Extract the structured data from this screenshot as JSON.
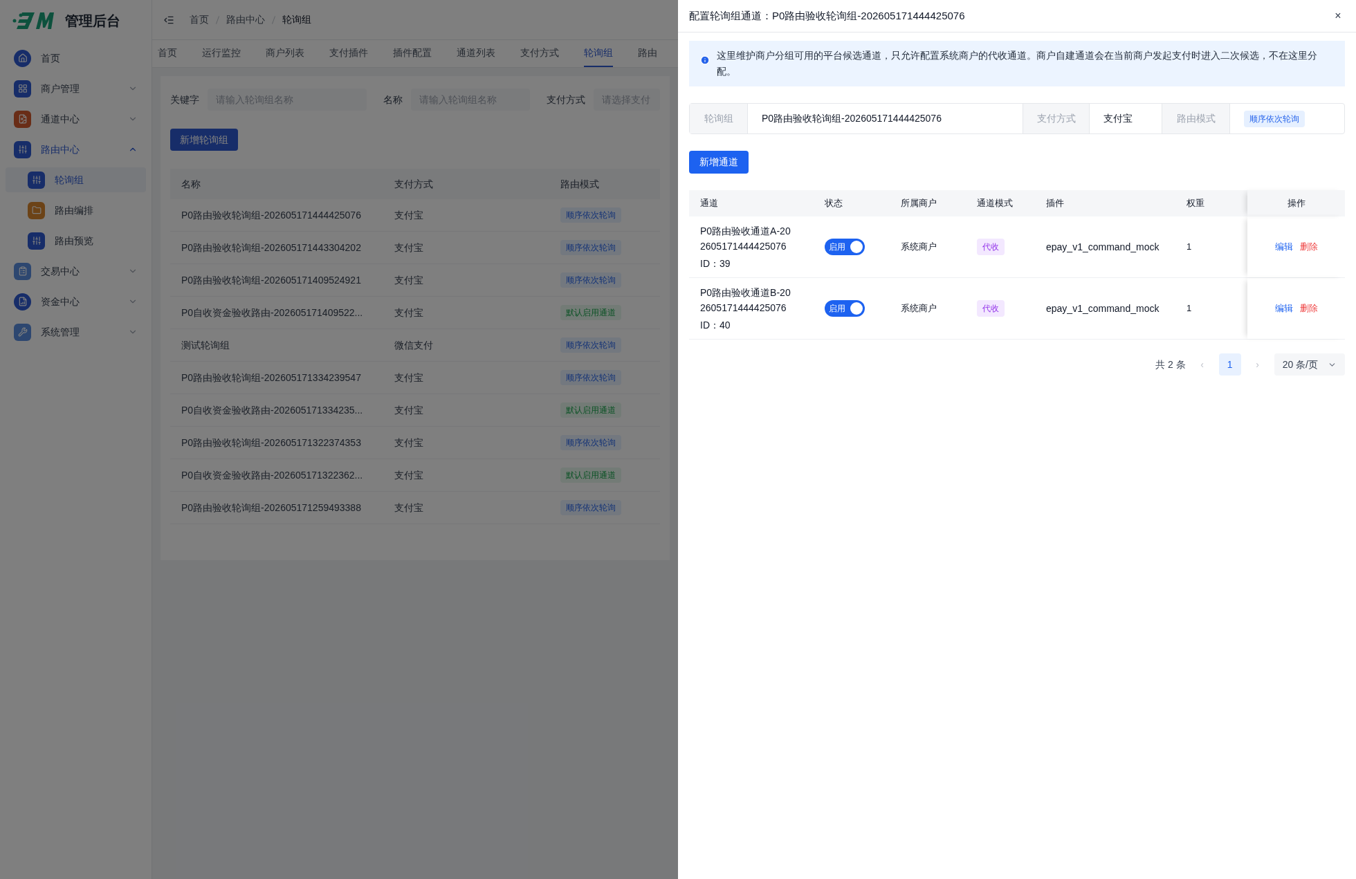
{
  "sidebar": {
    "title": "管理后台",
    "items": [
      {
        "label": "首页",
        "selected": false
      },
      {
        "label": "商户管理",
        "selected": false,
        "expanded": false
      },
      {
        "label": "通道中心",
        "selected": false,
        "expanded": false
      },
      {
        "label": "路由中心",
        "selected": true,
        "expanded": true,
        "children": [
          {
            "label": "轮询组",
            "selected": true
          },
          {
            "label": "路由编排",
            "selected": false
          },
          {
            "label": "路由预览",
            "selected": false
          }
        ]
      },
      {
        "label": "交易中心",
        "selected": false,
        "expanded": false
      },
      {
        "label": "资金中心",
        "selected": false,
        "expanded": false
      },
      {
        "label": "系统管理",
        "selected": false,
        "expanded": false
      }
    ]
  },
  "breadcrumb": [
    "首页",
    "路由中心",
    "轮询组"
  ],
  "tabs": [
    {
      "label": "首页",
      "selected": false
    },
    {
      "label": "运行监控",
      "selected": false
    },
    {
      "label": "商户列表",
      "selected": false
    },
    {
      "label": "支付插件",
      "selected": false
    },
    {
      "label": "插件配置",
      "selected": false
    },
    {
      "label": "通道列表",
      "selected": false
    },
    {
      "label": "支付方式",
      "selected": false
    },
    {
      "label": "轮询组",
      "selected": true
    },
    {
      "label": "路由",
      "selected": false
    }
  ],
  "filters": [
    {
      "label": "关键字",
      "placeholder": "请输入轮询组名称"
    },
    {
      "label": "名称",
      "placeholder": "请输入轮询组名称"
    },
    {
      "label": "支付方式",
      "placeholder": "请选择支付"
    }
  ],
  "add_button": "新增轮询组",
  "table": {
    "columns": [
      "名称",
      "支付方式",
      "路由模式"
    ],
    "rows": [
      {
        "name": "P0路由验收轮询组-202605171444425076",
        "pay": "支付宝",
        "mode": "顺序依次轮询",
        "kind": "sequential"
      },
      {
        "name": "P0路由验收轮询组-202605171443304202",
        "pay": "支付宝",
        "mode": "顺序依次轮询",
        "kind": "sequential"
      },
      {
        "name": "P0路由验收轮询组-202605171409524921",
        "pay": "支付宝",
        "mode": "顺序依次轮询",
        "kind": "sequential"
      },
      {
        "name": "P0自收资金验收路由-202605171409522...",
        "pay": "支付宝",
        "mode": "默认启用通道",
        "kind": "default"
      },
      {
        "name": "测试轮询组",
        "pay": "微信支付",
        "mode": "顺序依次轮询",
        "kind": "sequential"
      },
      {
        "name": "P0路由验收轮询组-202605171334239547",
        "pay": "支付宝",
        "mode": "顺序依次轮询",
        "kind": "sequential"
      },
      {
        "name": "P0自收资金验收路由-202605171334235...",
        "pay": "支付宝",
        "mode": "默认启用通道",
        "kind": "default"
      },
      {
        "name": "P0路由验收轮询组-202605171322374353",
        "pay": "支付宝",
        "mode": "顺序依次轮询",
        "kind": "sequential"
      },
      {
        "name": "P0自收资金验收路由-202605171322362...",
        "pay": "支付宝",
        "mode": "默认启用通道",
        "kind": "default"
      },
      {
        "name": "P0路由验收轮询组-202605171259493388",
        "pay": "支付宝",
        "mode": "顺序依次轮询",
        "kind": "sequential"
      }
    ]
  },
  "drawer": {
    "title": "配置轮询组通道：P0路由验收轮询组-202605171444425076",
    "close": "×",
    "alert": "这里维护商户分组可用的平台候选通道，只允许配置系统商户的代收通道。商户自建通道会在当前商户发起支付时进入二次候选，不在这里分配。",
    "descriptions": [
      {
        "label": "轮询组",
        "value": "P0路由验收轮询组-202605171444425076"
      },
      {
        "label": "支付方式",
        "value": "支付宝"
      },
      {
        "label": "路由模式",
        "value": "顺序依次轮询",
        "kind": "tag"
      }
    ],
    "add_button": "新增通道",
    "columns": [
      "通道",
      "状态",
      "所属商户",
      "通道模式",
      "插件",
      "权重",
      "操作"
    ],
    "rows": [
      {
        "channel": "P0路由验收通道A-202605171444425076",
        "id": "ID：39",
        "on": true,
        "switch_label": "启用",
        "merchant": "系统商户",
        "mode": "代收",
        "plugin": "epay_v1_command_mock",
        "weight": "1",
        "actions": [
          "编辑",
          "删除"
        ]
      },
      {
        "channel": "P0路由验收通道B-202605171444425076",
        "id": "ID：40",
        "on": true,
        "switch_label": "启用",
        "merchant": "系统商户",
        "mode": "代收",
        "plugin": "epay_v1_command_mock",
        "weight": "1",
        "actions": [
          "编辑",
          "删除"
        ]
      }
    ],
    "pagination": {
      "total": "共 2 条",
      "prev": "‹",
      "pages": [
        {
          "label": "1",
          "selected": true
        }
      ],
      "next": "›",
      "page_size": "20 条/页"
    }
  }
}
